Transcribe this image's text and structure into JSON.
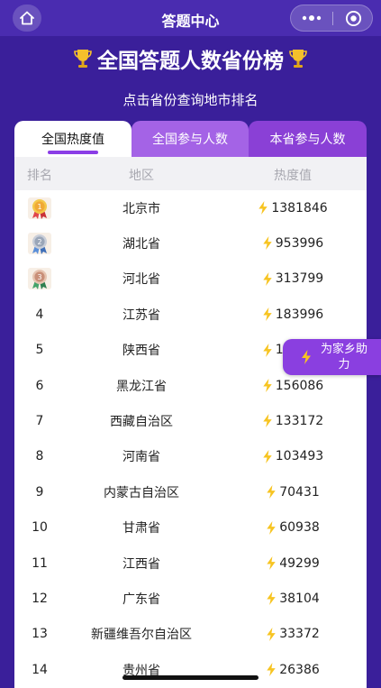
{
  "navbar": {
    "title": "答题中心",
    "home_icon": "home-icon",
    "more_icon": "more-dots-icon",
    "close_icon": "close-circle-icon"
  },
  "header": {
    "title": "全国答题人数省份榜",
    "title_icon": "trophy-icon",
    "subtitle": "点击省份查询地市排名"
  },
  "tabs": [
    {
      "label": "全国热度值",
      "active": true
    },
    {
      "label": "全国参与人数",
      "active": false
    },
    {
      "label": "本省参与人数",
      "active": false
    }
  ],
  "table": {
    "columns": [
      "排名",
      "地区",
      "热度值"
    ],
    "rows": [
      {
        "rank": "1",
        "region": "北京市",
        "heat": "1381846",
        "medal": "gold"
      },
      {
        "rank": "2",
        "region": "湖北省",
        "heat": "953996",
        "medal": "silver"
      },
      {
        "rank": "3",
        "region": "河北省",
        "heat": "313799",
        "medal": "bronze"
      },
      {
        "rank": "4",
        "region": "江苏省",
        "heat": "183996"
      },
      {
        "rank": "5",
        "region": "陕西省",
        "heat": "176615"
      },
      {
        "rank": "6",
        "region": "黑龙江省",
        "heat": "156086"
      },
      {
        "rank": "7",
        "region": "西藏自治区",
        "heat": "133172"
      },
      {
        "rank": "8",
        "region": "河南省",
        "heat": "103493"
      },
      {
        "rank": "9",
        "region": "内蒙古自治区",
        "heat": "70431"
      },
      {
        "rank": "10",
        "region": "甘肃省",
        "heat": "60938"
      },
      {
        "rank": "11",
        "region": "江西省",
        "heat": "49299"
      },
      {
        "rank": "12",
        "region": "广东省",
        "heat": "38104"
      },
      {
        "rank": "13",
        "region": "新疆维吾尔自治区",
        "heat": "33372"
      },
      {
        "rank": "14",
        "region": "贵州省",
        "heat": "26386"
      }
    ]
  },
  "support_button": {
    "label": "为家乡助力",
    "icon": "lightning-icon"
  },
  "colors": {
    "background": "#3a1f9a",
    "navbar": "#4a2cb0",
    "tab_mid": "#a463e6",
    "tab_right": "#8a40d6",
    "accent": "#8b3ee6",
    "bolt": "#f7c421"
  }
}
